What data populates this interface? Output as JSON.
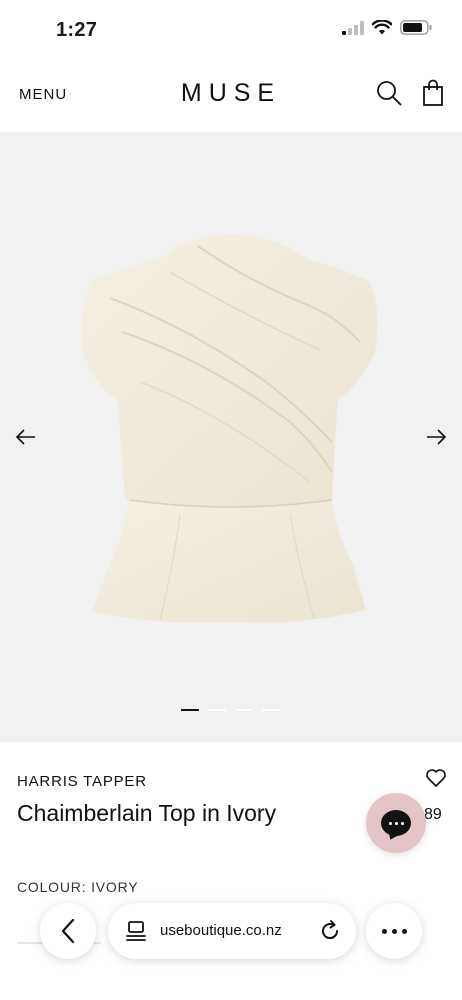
{
  "status_bar": {
    "time": "1:27"
  },
  "header": {
    "menu_label": "MENU",
    "logo": "MUSE"
  },
  "icons": {
    "search": "search-icon",
    "bag": "shopping-bag-icon",
    "arrow_prev": "arrow-left-icon",
    "arrow_next": "arrow-right-icon",
    "wishlist": "heart-icon",
    "chat": "chat-icon",
    "back": "chevron-left-icon",
    "tabs": "tabs-icon",
    "reload": "reload-icon",
    "more": "more-icon"
  },
  "gallery": {
    "image_count": 4,
    "active_index": 0,
    "background": "#f1f1f1",
    "garment_color": "#f1ebdc"
  },
  "product": {
    "brand": "HARRIS TAPPER",
    "title": "Chaimberlain Top in Ivory",
    "price_visible": "89",
    "colour_label": "COLOUR: IVORY"
  },
  "browser": {
    "url": "useboutique.co.nz"
  },
  "colors": {
    "chat_button": "#e3c5c8",
    "text": "#111111"
  }
}
